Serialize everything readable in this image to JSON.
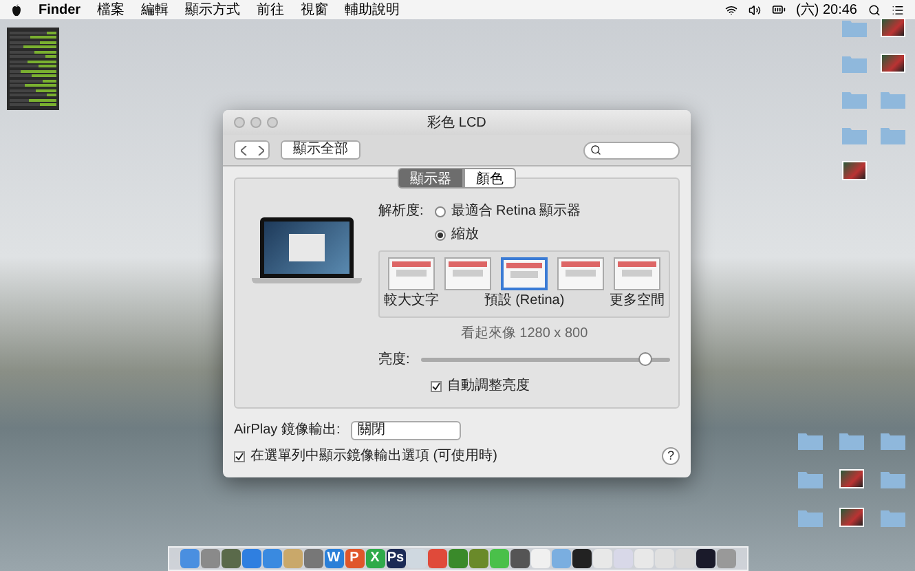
{
  "menu_bar": {
    "app": "Finder",
    "items": [
      "檔案",
      "編輯",
      "顯示方式",
      "前往",
      "視窗",
      "輔助說明"
    ],
    "clock": "(六) 20:46"
  },
  "desktop_icons": [
    {
      "kind": "folder"
    },
    {
      "kind": "image"
    },
    {
      "kind": "folder"
    },
    {
      "kind": "image"
    },
    {
      "kind": "folder"
    },
    {
      "kind": "folder"
    },
    {
      "kind": "folder"
    },
    {
      "kind": "folder"
    },
    {
      "kind": "image"
    }
  ],
  "desktop_icons_lower": [
    {
      "kind": "folder"
    },
    {
      "kind": "folder"
    },
    {
      "kind": "folder"
    },
    {
      "kind": "folder"
    },
    {
      "kind": "image"
    },
    {
      "kind": "folder"
    },
    {
      "kind": "folder"
    },
    {
      "kind": "image"
    },
    {
      "kind": "folder"
    }
  ],
  "window": {
    "title": "彩色 LCD",
    "show_all": "顯示全部",
    "tabs": [
      {
        "label": "顯示器",
        "selected": true
      },
      {
        "label": "顏色",
        "selected": false
      }
    ],
    "resolution": {
      "label": "解析度:",
      "options": [
        {
          "label": "最適合 Retina 顯示器",
          "selected": false
        },
        {
          "label": "縮放",
          "selected": true
        }
      ]
    },
    "scales": [
      {
        "label": "較大文字",
        "selected": false
      },
      {
        "selected": false
      },
      {
        "label": "預設 (Retina)",
        "selected": true
      },
      {
        "selected": false
      },
      {
        "label": "更多空間",
        "selected": false
      }
    ],
    "scale_hint": "看起來像 1280 x 800",
    "brightness": {
      "label": "亮度:",
      "level": 0.9
    },
    "auto_brightness": {
      "label": "自動調整亮度",
      "checked": true
    },
    "airplay": {
      "label": "AirPlay 鏡像輸出:",
      "value": "關閉"
    },
    "mirroring_option": {
      "label": "在選單列中顯示鏡像輸出選項 (可使用時)",
      "checked": true
    },
    "help": "?"
  },
  "dock": [
    {
      "color": "#4a8fe0"
    },
    {
      "color": "#8a8a8a"
    },
    {
      "color": "#5a6a4a"
    },
    {
      "color": "#2f7fe0"
    },
    {
      "color": "#3a8ae0"
    },
    {
      "color": "#c9a86a"
    },
    {
      "color": "#777777"
    },
    {
      "color": "#2a7fd8",
      "glyph": "W"
    },
    {
      "color": "#e0562a",
      "glyph": "P"
    },
    {
      "color": "#2faa4a",
      "glyph": "X"
    },
    {
      "color": "#1b2a55",
      "glyph": "Ps"
    },
    {
      "color": "#cfd8e0"
    },
    {
      "color": "#e04a3a"
    },
    {
      "color": "#3a8a2a"
    },
    {
      "color": "#6a8a2a"
    },
    {
      "color": "#4ac04a"
    },
    {
      "color": "#555555"
    },
    {
      "color": "#f0f0f0"
    },
    {
      "color": "#7aaee0"
    },
    {
      "color": "#222222"
    },
    {
      "color": "#e8e8e8"
    },
    {
      "color": "#d8d8e8"
    },
    {
      "color": "#e8e8e8"
    },
    {
      "color": "#e0e0e0"
    },
    {
      "color": "#d8d8d8"
    },
    {
      "color": "#1a1a2a"
    },
    {
      "color": "#999999"
    }
  ]
}
